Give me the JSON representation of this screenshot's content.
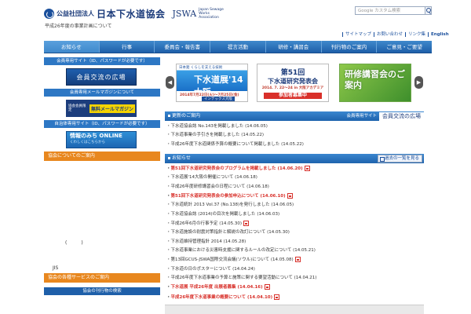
{
  "header": {
    "corp_type": "公益社団法人",
    "org_name": "日本下水道協会",
    "abbr": "JSWA",
    "org_name_en": "Japan Sewage Works Association",
    "note": "平成26年度の事業計画について",
    "search_placeholder": "Google カスタム検索",
    "util_links": [
      "サイトマップ",
      "お問い合わせ",
      "リンク集",
      "English"
    ]
  },
  "nav": [
    "お知らせ",
    "行事",
    "委員会・報告書",
    "提言活動",
    "研修・講習会",
    "刊行物のご案内",
    "ご意見・ご要望"
  ],
  "sidebar": {
    "member_site": "会員専用サイト（ID、パスワードが必要です）",
    "member_banner": "会員交流の広場",
    "mail_head": "会員専用メールマガジンについて",
    "mail_banner_small": "協会会員限定",
    "mail_banner_main": "無料メールマガジン",
    "local_site": "自治体専用サイト（ID、パスワードが必要です）",
    "joho_main": "情報のみち ONLINE",
    "joho_sub": "くわしくはこちらから",
    "about": "協会についてのご案内",
    "paren": "(　　　)",
    "jis": "JIS",
    "services": "協会の各種サービスのご案内",
    "publications_search": "協会の刊行物の検索"
  },
  "slides": {
    "s1_top": "日本発 くらしを支える技術",
    "s1_main": "下水道展'14大阪",
    "s1_date": "2014年7月22日(火)〜7月25日(金)",
    "s1_venue": "インテックス大阪",
    "s2_num": "第51回",
    "s2_title": "下水道研究発表会",
    "s2_date": "2014. 7. 22〜24 in 大阪アカデミア",
    "s2_cta": "参加者募集中",
    "s3_title": "研修講習会のご案内"
  },
  "updates": {
    "title": "更新のご案内",
    "member_label": "会員専用サイト",
    "member_banner": "会員交流の広場",
    "items": [
      {
        "text": "下水道協会誌 No.143を掲載しました",
        "date": "(14.06.05)"
      },
      {
        "text": "下水道事業の手引きを掲載しました",
        "date": "(14.05.22)"
      },
      {
        "text": "平成26年度下水道関係予算の概要について掲載しました",
        "date": "(14.05.22)"
      }
    ]
  },
  "news": {
    "title": "お知らせ",
    "archive": "過去の一覧を見る",
    "items": [
      {
        "text": "第51回下水道研究発表会のプログラムを掲載しました",
        "date": "(14.06.20)",
        "hot": true,
        "pdf": true
      },
      {
        "text": "下水道展'14大阪の開催について",
        "date": "(14.06.18)",
        "hot": false,
        "pdf": false
      },
      {
        "text": "平成26年度研修講習会の日程について",
        "date": "(14.06.18)",
        "hot": false,
        "pdf": false
      },
      {
        "text": "第51回下水道研究発表会の参加申込について",
        "date": "(14.06.10)",
        "hot": true,
        "pdf": true
      },
      {
        "text": "下水道統計 2013 Vol.37 (No.138)を発行しました",
        "date": "(14.06.05)",
        "hot": false,
        "pdf": false
      },
      {
        "text": "下水道協会誌 (2014)の目次を掲載しました",
        "date": "(14.06.03)",
        "hot": false,
        "pdf": false
      },
      {
        "text": "平成26年6月の行事予定",
        "date": "(14.05.30)",
        "hot": false,
        "pdf": true
      },
      {
        "text": "下水道施設の耐震対策指針と解説の改訂について",
        "date": "(14.05.30)",
        "hot": false,
        "pdf": false
      },
      {
        "text": "下水道維持管理指針 2014",
        "date": "(14.05.28)",
        "hot": false,
        "pdf": false
      },
      {
        "text": "下水道事業における災害時支援に関するルールの改定について",
        "date": "(14.05.21)",
        "hot": false,
        "pdf": false
      },
      {
        "text": "第13回GCUS-JSWA国際交流会議(ソウル)について",
        "date": "(14.05.08)",
        "hot": false,
        "pdf": true
      },
      {
        "text": "下水道の日のポスターについて",
        "date": "(14.04.24)",
        "hot": false,
        "pdf": false
      },
      {
        "text": "平成26年度下水道事業の予算と施策に関する要望活動について",
        "date": "(14.04.21)",
        "hot": false,
        "pdf": false
      },
      {
        "text": "下水道展 平成26年度 出展者募集",
        "date": "(14.04.16)",
        "hot": true,
        "pdf": true
      },
      {
        "text": "平成26年度下水道事業の概要について",
        "date": "(14.04.10)",
        "hot": true,
        "pdf": true
      }
    ]
  }
}
